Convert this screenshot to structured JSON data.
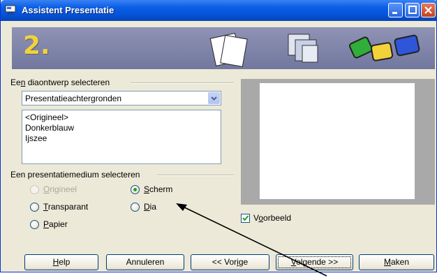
{
  "window": {
    "title": "Assistent Presentatie"
  },
  "banner": {
    "step": "2."
  },
  "design": {
    "label_pre": "Ee",
    "label_accel": "n",
    "label_post": " diaontwerp selecteren",
    "dropdown_value": "Presentatieachtergronden",
    "list_items": [
      "<Origineel>",
      "Donkerblauw",
      "Ijszee"
    ]
  },
  "medium": {
    "label": "Een presentatiemedium selecteren",
    "options": [
      {
        "accel": "O",
        "rest": "rigineel",
        "state": "disabled"
      },
      {
        "accel": "S",
        "rest": "cherm",
        "state": "checked"
      },
      {
        "accel": "T",
        "rest": "ransparant",
        "state": "unchecked"
      },
      {
        "accel": "D",
        "rest": "ia",
        "state": "unchecked"
      },
      {
        "accel": "P",
        "rest": "apier",
        "state": "unchecked"
      }
    ]
  },
  "preview": {
    "pre": "V",
    "accel": "o",
    "post": "orbeeld",
    "checked": true
  },
  "buttons": {
    "help": {
      "accel": "H",
      "rest": "elp"
    },
    "cancel": {
      "label": "Annuleren"
    },
    "back": {
      "pre": "<< Vor",
      "accel": "i",
      "post": "ge"
    },
    "next": {
      "accel": "V",
      "rest": "olgende >>"
    },
    "finish": {
      "accel": "M",
      "rest": "aken"
    }
  },
  "colors": {
    "titlebar": "#0553d8",
    "dialog": "#ece9d8",
    "banner": "#8f93b5",
    "step_number": "#f2d23a"
  }
}
